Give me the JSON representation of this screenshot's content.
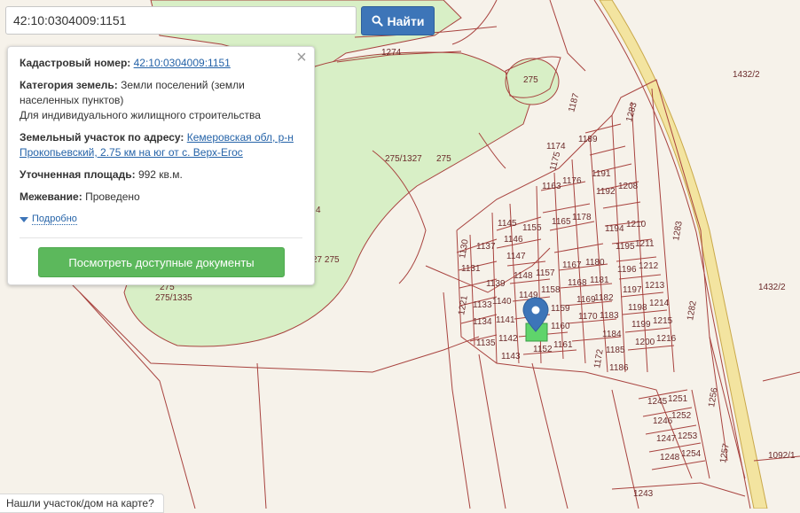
{
  "search": {
    "value": "42:10:0304009:1151",
    "button_label": "Найти"
  },
  "popup": {
    "cadastral_label": "Кадастровый номер:",
    "cadastral_value": "42:10:0304009:1151",
    "category_label": "Категория земель:",
    "category_value_1": "Земли поселений (земли",
    "category_value_2": "населенных пунктов)",
    "category_value_3": "Для индивидуального жилищного строительства",
    "address_label": "Земельный участок по адресу:",
    "address_value_1": "Кемеровская обл, р-н",
    "address_value_2": "Прокопьевский, 2.75 км на юг от с. Верх-Егос",
    "area_label": "Уточненная площадь:",
    "area_value": "992 кв.м.",
    "survey_label": "Межевание:",
    "survey_value": "Проведено",
    "more_link": "Подробно",
    "docs_button": "Посмотреть доступные документы",
    "close_symbol": "×"
  },
  "bottom_tab": "Нашли участок/дом на карте?",
  "map_labels": [
    "1274",
    "275",
    "1432/2",
    "1283",
    "1187",
    "1189",
    "1174",
    "1175",
    "275/1327",
    "275",
    "1191",
    "1176",
    "1163",
    "1192",
    "1208",
    "1145",
    "1155",
    "1165",
    "1178",
    "1194",
    "1210",
    "1137",
    "1146",
    "1283",
    "1130",
    "1147",
    "1195",
    "1211",
    "1131",
    "1148",
    "1157",
    "1167",
    "1180",
    "1196",
    "1212",
    "1432/2",
    "1139",
    "1149",
    "1158",
    "1168",
    "1181",
    "1197",
    "1213",
    "1221",
    "1133",
    "1140",
    "1159",
    "1169",
    "1182",
    "1198",
    "1214",
    "1282",
    "1134",
    "1141",
    "1160",
    "1170",
    "1183",
    "1199",
    "1215",
    "1135",
    "1142",
    "1152",
    "1161",
    "1184",
    "1200",
    "1216",
    "1143",
    "1172",
    "1185",
    "1186",
    "1251",
    "1256",
    "1245",
    "1252",
    "1246",
    "1253",
    "1247",
    "1254",
    "1257",
    "1248",
    "1092/1",
    "1243",
    "27 275",
    "275/1335",
    "4",
    "275"
  ],
  "colors": {
    "accent": "#3d75b8",
    "success": "#5cb85c",
    "parcel_line": "#a8433f",
    "green_area": "#d8efc6",
    "selected_parcel": "#5fd46b",
    "road": "#f3e4a0"
  },
  "icons": {
    "search": "search-icon",
    "marker": "location-pin-icon",
    "close": "close-icon",
    "more": "triangle-down-icon"
  }
}
